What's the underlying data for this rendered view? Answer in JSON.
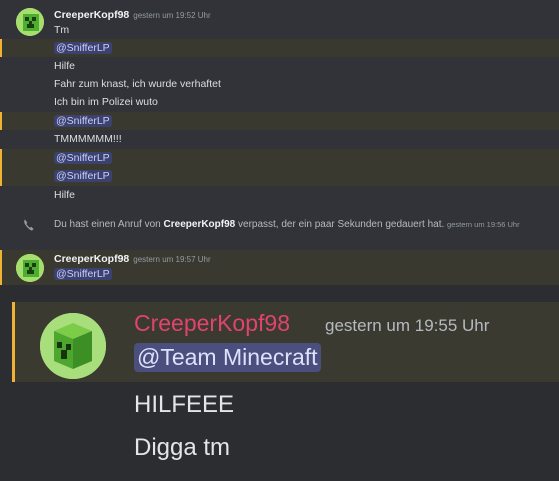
{
  "first_group": {
    "username": "CreeperKopf98",
    "timestamp": "gestern um 19:52 Uhr",
    "messages": [
      "Tm",
      "@SnifferLP",
      "Hilfe",
      "Fahr zum knast, ich wurde verhaftet",
      "Ich bin im Polizei wuto",
      "@SnifferLP",
      "TMMMMMM!!!",
      "@SnifferLP",
      "@SnifferLP",
      "Hilfe"
    ]
  },
  "missed_call": {
    "prefix": "Du hast einen Anruf von",
    "caller": "CreeperKopf98",
    "suffix": "verpasst, der ein paar Sekunden gedauert hat.",
    "timestamp": "gestern um 19:56 Uhr",
    "icon": "phone-icon"
  },
  "second_group": {
    "username": "CreeperKopf98",
    "timestamp": "gestern um 19:57 Uhr",
    "messages": [
      "@SnifferLP"
    ]
  },
  "zoomed_group": {
    "username": "CreeperKopf98",
    "timestamp": "gestern um 19:55 Uhr",
    "mention": "@Team Minecraft",
    "messages": [
      "HILFEEE",
      "Digga tm"
    ]
  },
  "colors": {
    "background": "#313338",
    "mention_highlight": "#f0b232",
    "mention_text": "#c9cdfb",
    "zoomed_username": "#e0436e"
  }
}
